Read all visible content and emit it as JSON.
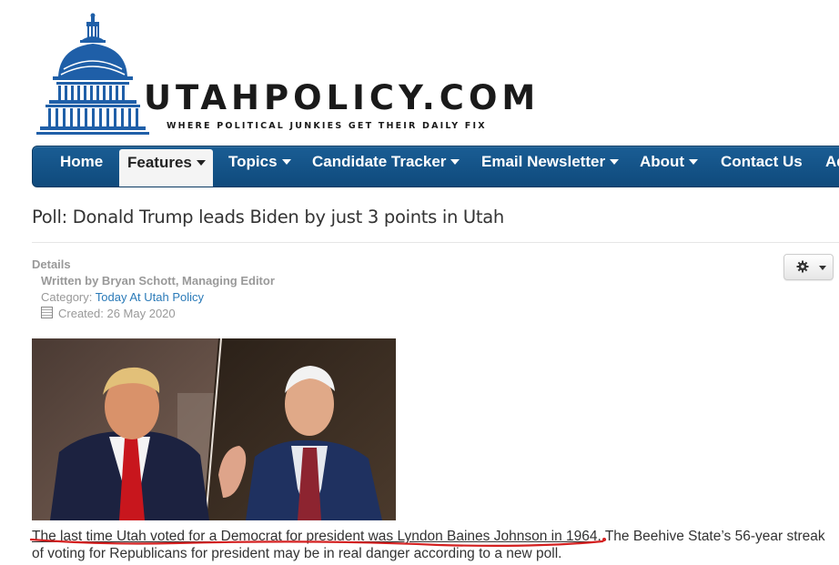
{
  "site": {
    "title": "UTAHPOLICY.COM",
    "tagline": "WHERE POLITICAL JUNKIES GET THEIR DAILY FIX"
  },
  "nav": {
    "items": [
      {
        "label": "Home",
        "dropdown": false,
        "active": false
      },
      {
        "label": "Features",
        "dropdown": true,
        "active": true
      },
      {
        "label": "Topics",
        "dropdown": true,
        "active": false
      },
      {
        "label": "Candidate Tracker",
        "dropdown": true,
        "active": false
      },
      {
        "label": "Email Newsletter",
        "dropdown": true,
        "active": false
      },
      {
        "label": "About",
        "dropdown": true,
        "active": false
      },
      {
        "label": "Contact Us",
        "dropdown": false,
        "active": false
      },
      {
        "label": "Ad",
        "dropdown": false,
        "active": false
      }
    ]
  },
  "article": {
    "title": "Poll: Donald Trump leads Biden by just 3 points in Utah",
    "details_heading": "Details",
    "author": "Written by Bryan Schott, Managing Editor",
    "category_label": "Category:",
    "category_link": "Today At Utah Policy",
    "created": "Created: 26 May 2020",
    "body_underlined": "The last time Utah voted for a Democrat for president was Lyndon Baines Johnson in 1964",
    "body_rest": ". The Beehive State’s 56-year streak of voting for Republicans for president may be in real danger according to a new poll."
  },
  "icons": {
    "logo": "capitol-dome-icon",
    "tools": "gear-icon",
    "created": "calendar-icon"
  },
  "colors": {
    "nav_bg": "#1a5d94",
    "logo_blue": "#1f5fa8",
    "link": "#2a7ab8",
    "annotation_red": "#d42020"
  }
}
